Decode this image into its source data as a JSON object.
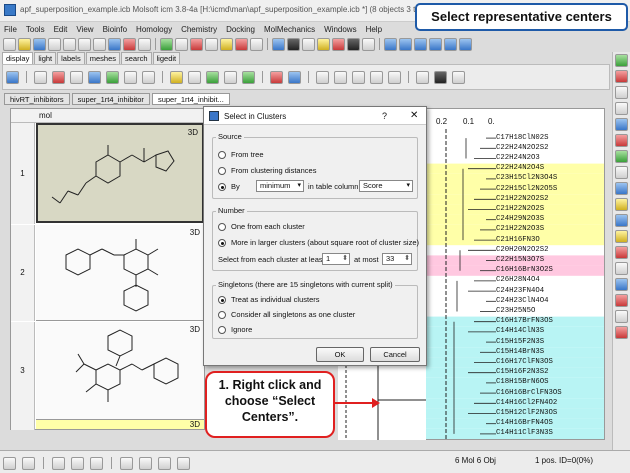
{
  "window": {
    "title": "apf_superposition_example.icb Molsoft icm 3.8-4a  [H:\\icmd\\man\\apf_superposition_example.icb *] (8 objects 3 ta"
  },
  "callout_top": "Select representative centers",
  "menu": [
    "File",
    "Tools",
    "Edit",
    "View",
    "Bioinfo",
    "Homology",
    "Chemistry",
    "Docking",
    "MolMechanics",
    "Windows",
    "Help"
  ],
  "ribbon_tabs": [
    "display",
    "light",
    "labels",
    "meshes",
    "search",
    "ligedit"
  ],
  "doc_tabs": [
    "hivRT_inhibitors",
    "super_1rt4_inhibitor",
    "super_1rt4_inhibit..."
  ],
  "table": {
    "column": "mol",
    "rows": [
      {
        "num": "1",
        "tag": "3D"
      },
      {
        "num": "2",
        "tag": "3D"
      },
      {
        "num": "3",
        "tag": "3D"
      },
      {
        "num": "",
        "tag": "3D"
      }
    ]
  },
  "tree": {
    "scale": [
      "0.2",
      "0.1",
      "0."
    ],
    "leaves": [
      {
        "text": "C17H18ClN02S",
        "hl": "none"
      },
      {
        "text": "C22H24N2O2S2",
        "hl": "none"
      },
      {
        "text": "C22H24N2O3",
        "hl": "none"
      },
      {
        "text": "C22H24N2O4S",
        "hl": "yellow"
      },
      {
        "text": "C23H15Cl2N3O4S",
        "hl": "yellow"
      },
      {
        "text": "C22H15Cl2N2O5S",
        "hl": "yellow"
      },
      {
        "text": "C21H22N2O2S2",
        "hl": "yellow"
      },
      {
        "text": "C21H22N2O2S",
        "hl": "yellow"
      },
      {
        "text": "C24H29N2O3S",
        "hl": "yellow"
      },
      {
        "text": "C21H22N2O3S",
        "hl": "yellow"
      },
      {
        "text": "C21H16FN3O",
        "hl": "yellow"
      },
      {
        "text": "C20H20N2O2S2",
        "hl": "none"
      },
      {
        "text": "C22H15N3O7S",
        "hl": "pink"
      },
      {
        "text": "C16H16BrN3O2S",
        "hl": "pink"
      },
      {
        "text": "C26H28N4O4",
        "hl": "none"
      },
      {
        "text": "C24H23FN4O4",
        "hl": "none"
      },
      {
        "text": "C24H23ClN4O4",
        "hl": "none"
      },
      {
        "text": "C23H25N5O",
        "hl": "none"
      },
      {
        "text": "C16H17BrFN3OS",
        "hl": "cyan"
      },
      {
        "text": "C14H14ClN3S",
        "hl": "cyan"
      },
      {
        "text": "C15H15F2N3S",
        "hl": "cyan"
      },
      {
        "text": "C15H14BrN3S",
        "hl": "cyan"
      },
      {
        "text": "C16H17ClFN3OS",
        "hl": "cyan"
      },
      {
        "text": "C15H16F2N3S2",
        "hl": "cyan"
      },
      {
        "text": "C18H15BrN6OS",
        "hl": "cyan"
      },
      {
        "text": "C16H16BrClFN3OS",
        "hl": "cyan"
      },
      {
        "text": "C14H16Cl2FN4O2",
        "hl": "cyan"
      },
      {
        "text": "C15H12ClF2N3OS",
        "hl": "cyan"
      },
      {
        "text": "C14H16BrFN4OS",
        "hl": "cyan"
      },
      {
        "text": "C14H11ClF3N3S",
        "hl": "cyan"
      }
    ]
  },
  "dialog": {
    "title": "Select in Clusters",
    "help": "?",
    "close": "✕",
    "source": {
      "label": "Source",
      "from_tree": "From tree",
      "from_distances": "From clustering distances",
      "by": "By",
      "by_value": "minimum",
      "in_column": "in table column",
      "column_value": "Score"
    },
    "number": {
      "label": "Number",
      "one": "One from each cluster",
      "more": "More in larger clusters (about square root of cluster size)",
      "select_label": "Select from each cluster at least",
      "at_least": "1",
      "at_most_label": "at most",
      "at_most": "33"
    },
    "singletons": {
      "label": "Singletons (there are 15 singletons with current split)",
      "treat": "Treat as individual clusters",
      "consider": "Consider all singletons as one cluster",
      "ignore": "Ignore"
    },
    "ok": "OK",
    "cancel": "Cancel"
  },
  "callout_instruction": "1. Right click and choose “Select Centers”.",
  "status": {
    "counts": "6 Mol 6 Obj",
    "position": "1 pos. ID=0(0%)"
  },
  "colors": {
    "yellow": "#ffffa8",
    "pink": "#ffc8e0",
    "cyan": "#b8f4f4",
    "callout_blue": "#1e5aa8",
    "callout_red": "#e02020"
  }
}
